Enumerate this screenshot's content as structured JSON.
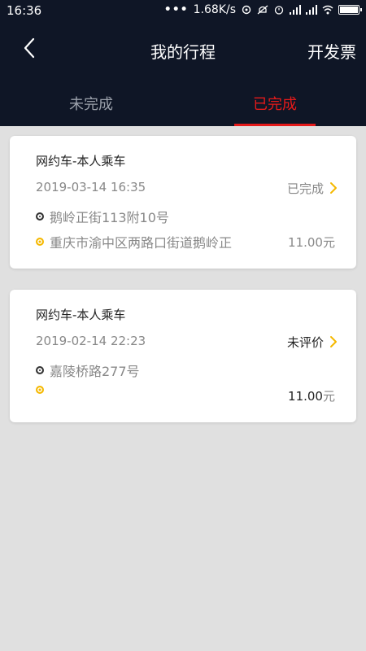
{
  "status_bar": {
    "time": "16:36",
    "dots": "•••",
    "speed": "1.68K/s"
  },
  "nav": {
    "title": "我的行程",
    "right_action": "开发票"
  },
  "tabs": [
    {
      "label": "未完成",
      "active": false
    },
    {
      "label": "已完成",
      "active": true
    }
  ],
  "colors": {
    "header_bg": "#0f1626",
    "accent_red": "#e51a1a",
    "accent_yellow": "#f5b800"
  },
  "trips": [
    {
      "type": "网约车-本人乘车",
      "time": "2019-03-14 16:35",
      "status": "已完成",
      "from": "鹅岭正街113附10号",
      "to": "重庆市渝中区两路口街道鹅岭正",
      "price": "11.00",
      "price_unit": "元"
    },
    {
      "type": "网约车-本人乘车",
      "time": "2019-02-14 22:23",
      "status": "未评价",
      "from": "嘉陵桥路277号",
      "to": "",
      "price": "11.00",
      "price_unit": "元"
    }
  ],
  "icons": {
    "back": "chevron-left-icon",
    "item_arrow": "chevron-right-icon"
  }
}
